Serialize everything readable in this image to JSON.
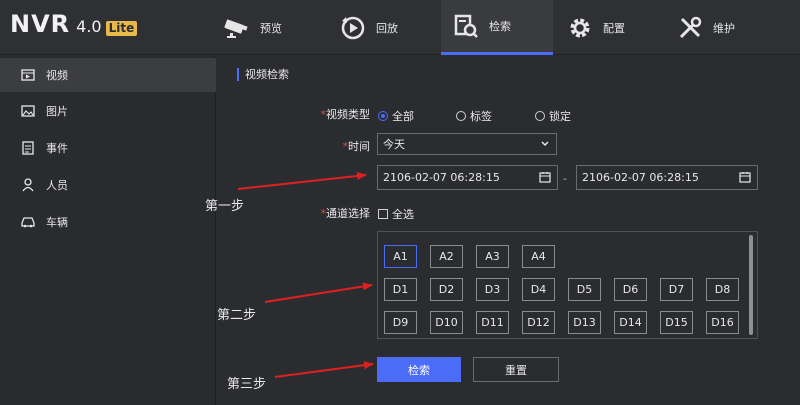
{
  "logo": {
    "main": "NVR",
    "version": "4.0",
    "edition": "Lite"
  },
  "nav": [
    {
      "label": "预览",
      "icon": "camera-icon"
    },
    {
      "label": "回放",
      "icon": "playback-icon"
    },
    {
      "label": "检索",
      "icon": "search-doc-icon"
    },
    {
      "label": "配置",
      "icon": "gear-icon"
    },
    {
      "label": "维护",
      "icon": "tools-icon"
    }
  ],
  "sidebar": [
    {
      "label": "视频",
      "icon": "video-icon"
    },
    {
      "label": "图片",
      "icon": "image-icon"
    },
    {
      "label": "事件",
      "icon": "event-icon"
    },
    {
      "label": "人员",
      "icon": "person-icon"
    },
    {
      "label": "车辆",
      "icon": "car-icon"
    }
  ],
  "main": {
    "section_title": "视频检索",
    "video_type": {
      "label": "视频类型",
      "options": [
        "全部",
        "标签",
        "锁定"
      ],
      "selected": "全部"
    },
    "time": {
      "label": "时间",
      "value": "今天",
      "start": "2106-02-07 06:28:15",
      "separator": "-",
      "end": "2106-02-07 06:28:15"
    },
    "channel": {
      "label": "通道选择",
      "select_all": "全选",
      "analog": [
        "A1",
        "A2",
        "A3",
        "A4"
      ],
      "digital": [
        "D1",
        "D2",
        "D3",
        "D4",
        "D5",
        "D6",
        "D7",
        "D8",
        "D9",
        "D10",
        "D11",
        "D12",
        "D13",
        "D14",
        "D15",
        "D16"
      ]
    },
    "search_button": "检索",
    "reset_button": "重置"
  },
  "annotations": {
    "step1": "第一步",
    "step2": "第二步",
    "step3": "第三步"
  },
  "colors": {
    "accent": "#4a6cf7",
    "arrow": "#e02020",
    "required": "#e74c3c",
    "lite_badge": "#e8b84a"
  }
}
